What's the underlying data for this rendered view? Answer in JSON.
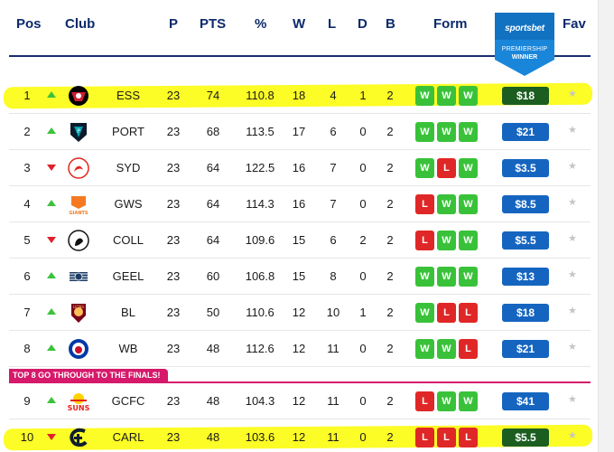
{
  "header": {
    "pos": "Pos",
    "club": "Club",
    "p": "P",
    "pts": "PTS",
    "pct": "%",
    "w": "W",
    "l": "L",
    "d": "D",
    "b": "B",
    "form": "Form",
    "fav": "Fav"
  },
  "sponsor": {
    "brand": "sportsbet",
    "line1": "PREMIERSHIP",
    "line2": "WINNER"
  },
  "banner": {
    "text": "TOP 8 GO THROUGH TO THE FINALS!"
  },
  "colors": {
    "win": "#39c239",
    "loss": "#e02727",
    "odds": "#1565c0",
    "odds_highlight": "#1b5e20",
    "highlight": "#fcfc26",
    "banner": "#d6196a",
    "header_text": "#0d2a6b"
  },
  "rows": [
    {
      "pos": "1",
      "move": "up",
      "team": "ESS",
      "badge": "bomber-icon",
      "p": "23",
      "pts": "74",
      "pct": "110.8",
      "w": "18",
      "l": "4",
      "d": "1",
      "b": "2",
      "form": [
        "W",
        "W",
        "W"
      ],
      "odds": "$18",
      "highlight": true
    },
    {
      "pos": "2",
      "move": "up",
      "team": "PORT",
      "badge": "power-icon",
      "p": "23",
      "pts": "68",
      "pct": "113.5",
      "w": "17",
      "l": "6",
      "d": "0",
      "b": "2",
      "form": [
        "W",
        "W",
        "W"
      ],
      "odds": "$21",
      "highlight": false
    },
    {
      "pos": "3",
      "move": "down",
      "team": "SYD",
      "badge": "swan-icon",
      "p": "23",
      "pts": "64",
      "pct": "122.5",
      "w": "16",
      "l": "7",
      "d": "0",
      "b": "2",
      "form": [
        "W",
        "L",
        "W"
      ],
      "odds": "$3.5",
      "highlight": false
    },
    {
      "pos": "4",
      "move": "up",
      "team": "GWS",
      "badge": "giants-icon",
      "p": "23",
      "pts": "64",
      "pct": "114.3",
      "w": "16",
      "l": "7",
      "d": "0",
      "b": "2",
      "form": [
        "L",
        "W",
        "W"
      ],
      "odds": "$8.5",
      "highlight": false
    },
    {
      "pos": "5",
      "move": "down",
      "team": "COLL",
      "badge": "magpie-icon",
      "p": "23",
      "pts": "64",
      "pct": "109.6",
      "w": "15",
      "l": "6",
      "d": "2",
      "b": "2",
      "form": [
        "L",
        "W",
        "W"
      ],
      "odds": "$5.5",
      "highlight": false
    },
    {
      "pos": "6",
      "move": "up",
      "team": "GEEL",
      "badge": "cat-icon",
      "p": "23",
      "pts": "60",
      "pct": "106.8",
      "w": "15",
      "l": "8",
      "d": "0",
      "b": "2",
      "form": [
        "W",
        "W",
        "W"
      ],
      "odds": "$13",
      "highlight": false
    },
    {
      "pos": "7",
      "move": "up",
      "team": "BL",
      "badge": "lion-icon",
      "p": "23",
      "pts": "50",
      "pct": "110.6",
      "w": "12",
      "l": "10",
      "d": "1",
      "b": "2",
      "form": [
        "W",
        "L",
        "L"
      ],
      "odds": "$18",
      "highlight": false
    },
    {
      "pos": "8",
      "move": "up",
      "team": "WB",
      "badge": "bulldog-icon",
      "p": "23",
      "pts": "48",
      "pct": "112.6",
      "w": "12",
      "l": "11",
      "d": "0",
      "b": "2",
      "form": [
        "W",
        "W",
        "L"
      ],
      "odds": "$21",
      "highlight": false
    },
    {
      "pos": "9",
      "move": "up",
      "team": "GCFC",
      "badge": "suns-icon",
      "p": "23",
      "pts": "48",
      "pct": "104.3",
      "w": "12",
      "l": "11",
      "d": "0",
      "b": "2",
      "form": [
        "L",
        "W",
        "W"
      ],
      "odds": "$41",
      "highlight": false
    },
    {
      "pos": "10",
      "move": "down",
      "team": "CARL",
      "badge": "carlton-icon",
      "p": "23",
      "pts": "48",
      "pct": "103.6",
      "w": "12",
      "l": "11",
      "d": "0",
      "b": "2",
      "form": [
        "L",
        "L",
        "L"
      ],
      "odds": "$5.5",
      "highlight": true
    }
  ]
}
